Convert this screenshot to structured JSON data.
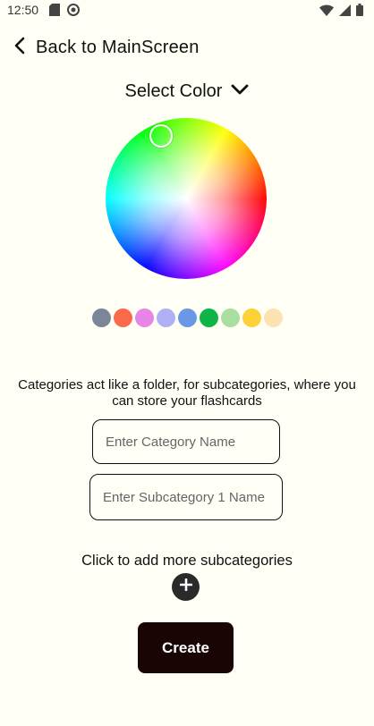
{
  "status_bar": {
    "time": "12:50",
    "left_icons": [
      "sd-card-icon",
      "sync-icon"
    ],
    "right_icons": [
      "wifi-icon",
      "signal-icon",
      "battery-icon"
    ]
  },
  "header": {
    "back_label": "Back to MainScreen",
    "back_icon": "chevron-left-icon"
  },
  "color_picker": {
    "label": "Select Color",
    "dropdown_icon": "chevron-down-icon",
    "swatches": [
      "#7b8797",
      "#fb6a4b",
      "#e886e8",
      "#b0b0f6",
      "#6a98e6",
      "#10b54a",
      "#a8dfa0",
      "#fcd238",
      "#fde2b2"
    ]
  },
  "info_text": "Categories act like a folder, for subcategories, where you can store your flashcards",
  "inputs": {
    "category_placeholder": "Enter Category Name",
    "category_value": "",
    "subcategory_placeholder": "Enter Subcategory 1 Name",
    "subcategory_value": ""
  },
  "add_hint": "Click to add more subcategories",
  "add_icon": "plus-icon",
  "create_label": "Create"
}
